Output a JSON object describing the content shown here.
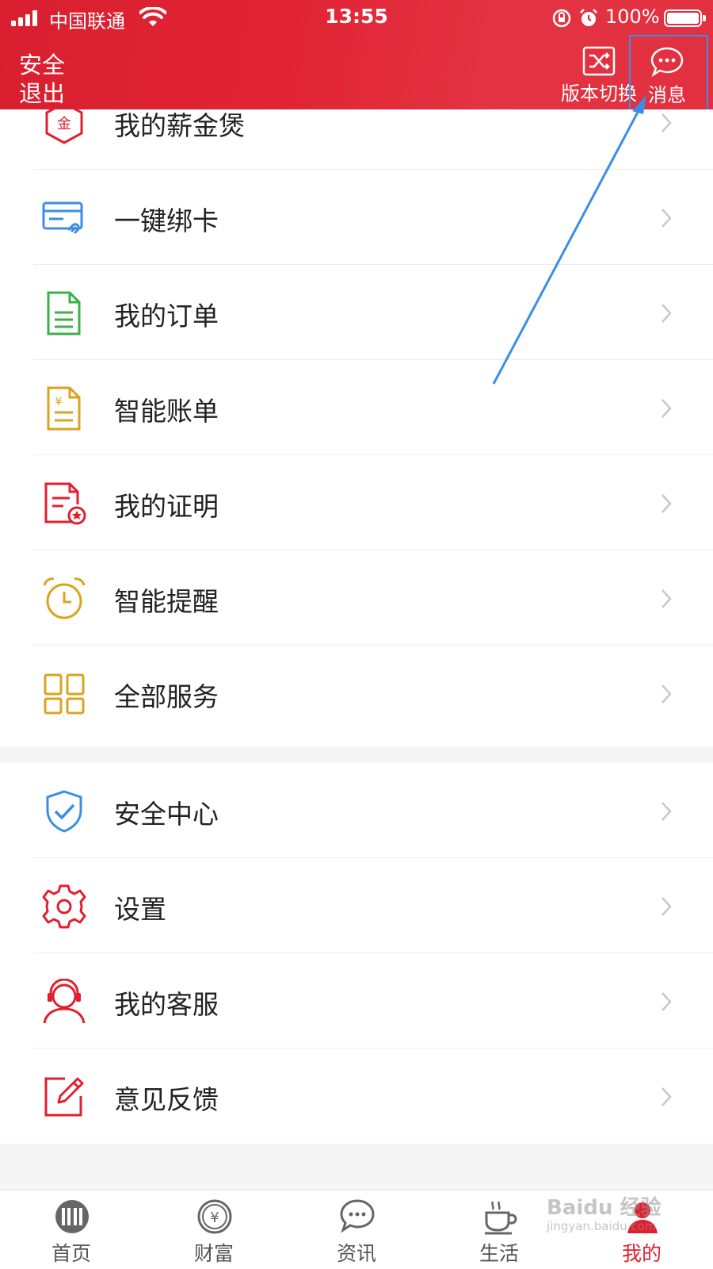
{
  "status_bar": {
    "carrier": "中国联通",
    "time": "13:55",
    "battery": "100%"
  },
  "header": {
    "logout_label": "安全\n退出",
    "switch_label": "版本切换",
    "message_label": "消息"
  },
  "menu_group1": [
    {
      "label": "我的薪金煲",
      "icon": "salary-treasure-icon",
      "color": "#e0202f"
    },
    {
      "label": "一键绑卡",
      "icon": "bind-card-icon",
      "color": "#3a8ee6"
    },
    {
      "label": "我的订单",
      "icon": "order-document-icon",
      "color": "#3bb14a"
    },
    {
      "label": "智能账单",
      "icon": "bill-document-icon",
      "color": "#d9a520"
    },
    {
      "label": "我的证明",
      "icon": "certificate-icon",
      "color": "#e0202f"
    },
    {
      "label": "智能提醒",
      "icon": "alarm-clock-icon",
      "color": "#d9a520"
    },
    {
      "label": "全部服务",
      "icon": "grid-services-icon",
      "color": "#d9a520"
    }
  ],
  "menu_group2": [
    {
      "label": "安全中心",
      "icon": "shield-check-icon",
      "color": "#3a8ee6"
    },
    {
      "label": "设置",
      "icon": "gear-icon",
      "color": "#e0202f"
    },
    {
      "label": "我的客服",
      "icon": "customer-service-icon",
      "color": "#e0202f"
    },
    {
      "label": "意见反馈",
      "icon": "feedback-edit-icon",
      "color": "#e0202f"
    }
  ],
  "tabs": [
    {
      "label": "首页",
      "icon": "home-logo-icon",
      "active": false
    },
    {
      "label": "财富",
      "icon": "wealth-yen-icon",
      "active": false
    },
    {
      "label": "资讯",
      "icon": "news-chat-icon",
      "active": false
    },
    {
      "label": "生活",
      "icon": "life-cup-icon",
      "active": false
    },
    {
      "label": "我的",
      "icon": "profile-icon",
      "active": true
    }
  ],
  "watermark": {
    "brand": "Baidu 经验",
    "url": "jingyan.baidu.com"
  },
  "colors": {
    "brand_red": "#e12434",
    "annotation_blue": "#3a8ee6"
  }
}
